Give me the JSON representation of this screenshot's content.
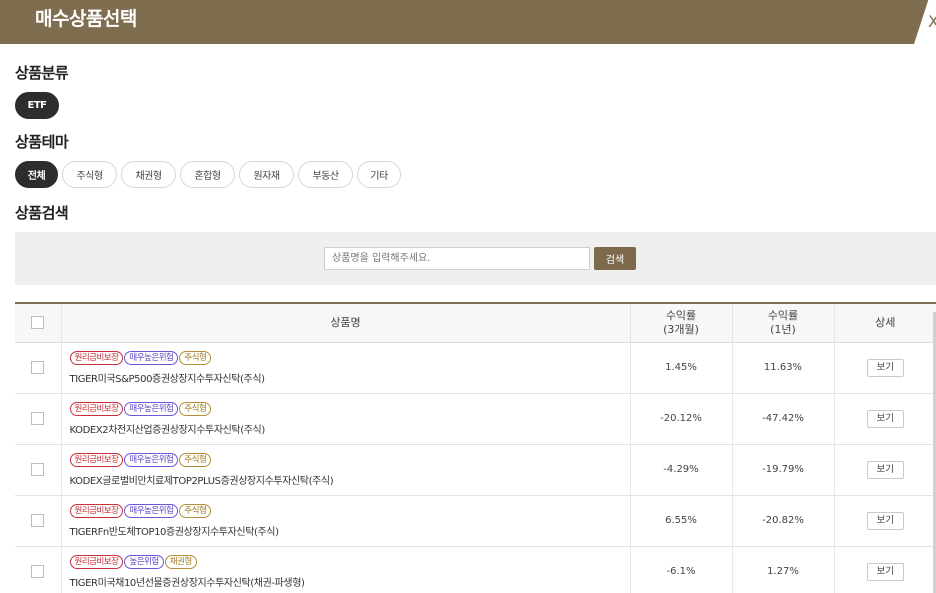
{
  "header": {
    "title": "매수상품선택",
    "close_glyph": "X"
  },
  "category": {
    "title": "상품분류",
    "chips": [
      {
        "label": "ETF",
        "active": true
      }
    ]
  },
  "theme": {
    "title": "상품테마",
    "chips": [
      {
        "label": "전체",
        "active": true
      },
      {
        "label": "주식형",
        "active": false
      },
      {
        "label": "채권형",
        "active": false
      },
      {
        "label": "혼합형",
        "active": false
      },
      {
        "label": "원자재",
        "active": false
      },
      {
        "label": "부동산",
        "active": false
      },
      {
        "label": "기타",
        "active": false
      }
    ]
  },
  "search": {
    "title": "상품검색",
    "placeholder": "상품명을 입력해주세요.",
    "button_label": "검색"
  },
  "table": {
    "headers": {
      "name": "상품명",
      "return_3m_line1": "수익률",
      "return_3m_line2": "(3개월)",
      "return_1y_line1": "수익률",
      "return_1y_line2": "(1년)",
      "detail": "상세"
    },
    "rows": [
      {
        "badges": [
          {
            "label": "원리금비보장",
            "tone": "red"
          },
          {
            "label": "매우높은위험",
            "tone": "purple"
          },
          {
            "label": "주식형",
            "tone": "gold"
          }
        ],
        "name": "TIGER미국S&P500증권상장지수투자신탁(주식)",
        "return_3m": "1.45%",
        "return_1y": "11.63%",
        "detail_label": "보기"
      },
      {
        "badges": [
          {
            "label": "원리금비보장",
            "tone": "red"
          },
          {
            "label": "매우높은위험",
            "tone": "purple"
          },
          {
            "label": "주식형",
            "tone": "gold"
          }
        ],
        "name": "KODEX2차전지산업증권상장지수투자신탁(주식)",
        "return_3m": "-20.12%",
        "return_1y": "-47.42%",
        "detail_label": "보기"
      },
      {
        "badges": [
          {
            "label": "원리금비보장",
            "tone": "red"
          },
          {
            "label": "매우높은위험",
            "tone": "purple"
          },
          {
            "label": "주식형",
            "tone": "gold"
          }
        ],
        "name": "KODEX글로벌비만치료제TOP2PLUS증권상장지수투자신탁(주식)",
        "return_3m": "-4.29%",
        "return_1y": "-19.79%",
        "detail_label": "보기"
      },
      {
        "badges": [
          {
            "label": "원리금비보장",
            "tone": "red"
          },
          {
            "label": "매우높은위험",
            "tone": "purple"
          },
          {
            "label": "주식형",
            "tone": "gold"
          }
        ],
        "name": "TIGERFn반도체TOP10증권상장지수투자신탁(주식)",
        "return_3m": "6.55%",
        "return_1y": "-20.82%",
        "detail_label": "보기"
      },
      {
        "badges": [
          {
            "label": "원리금비보장",
            "tone": "red"
          },
          {
            "label": "높은위험",
            "tone": "purple"
          },
          {
            "label": "채권형",
            "tone": "gold"
          }
        ],
        "name": "TIGER미국채10년선물증권상장지수투자신탁(채권-파생형)",
        "return_3m": "-6.1%",
        "return_1y": "1.27%",
        "detail_label": "보기"
      }
    ]
  },
  "colors": {
    "brand": "#7f6d4f",
    "search_button": "#7d6a4c",
    "chip_active": "#2d2d2d"
  }
}
